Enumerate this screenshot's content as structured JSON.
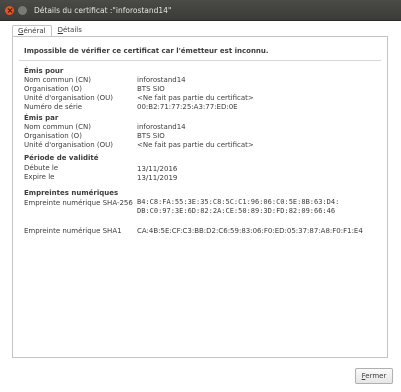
{
  "window": {
    "title": "Détails du certificat :\"inforostand14\""
  },
  "tabs": [
    {
      "label": "Général",
      "mnemonic": "G",
      "rest": "énéral"
    },
    {
      "label": "Détails",
      "mnemonic": "D",
      "rest": "étails"
    }
  ],
  "warning": "Impossible de vérifier ce certificat car l'émetteur est inconnu.",
  "issued_to": {
    "title": "Émis pour",
    "rows": [
      {
        "label": "Nom commun (CN)",
        "value": "inforostand14"
      },
      {
        "label": "Organisation (O)",
        "value": "BTS SIO"
      },
      {
        "label": "Unité d'organisation (OU)",
        "value": "<Ne fait pas partie du certificat>"
      },
      {
        "label": "Numéro de série",
        "value": "00:B2:71:77:25:A3:77:ED:0E"
      }
    ]
  },
  "issued_by": {
    "title": "Émis par",
    "rows": [
      {
        "label": "Nom commun (CN)",
        "value": "inforostand14"
      },
      {
        "label": "Organisation (O)",
        "value": "BTS SIO"
      },
      {
        "label": "Unité d'organisation (OU)",
        "value": "<Ne fait pas partie du certificat>"
      }
    ]
  },
  "validity": {
    "title": "Période de validité",
    "rows": [
      {
        "label": "Débute le",
        "value": "13/11/2016"
      },
      {
        "label": "Expire le",
        "value": "13/11/2019"
      }
    ]
  },
  "fingerprints": {
    "title": "Empreintes numériques",
    "sha256_label": "Empreinte numérique SHA-256",
    "sha256_line1": "B4:C8:FA:55:3E:35:C8:5C:C1:96:06:C0:5E:8B:63:D4:",
    "sha256_line2": "DB:C0:97:3E:6D:82:2A:CE:50:89:3D:FD:82:09:66:46",
    "sha1_label": "Empreinte numérique SHA1",
    "sha1_value": "CA:4B:5E:CF:C3:BB:D2:C6:59:83:06:F0:ED:05:37:87:A8:F0:F1:E4"
  },
  "buttons": {
    "close_label": "Fermer",
    "close_mnemonic": "F",
    "close_rest": "ermer"
  }
}
